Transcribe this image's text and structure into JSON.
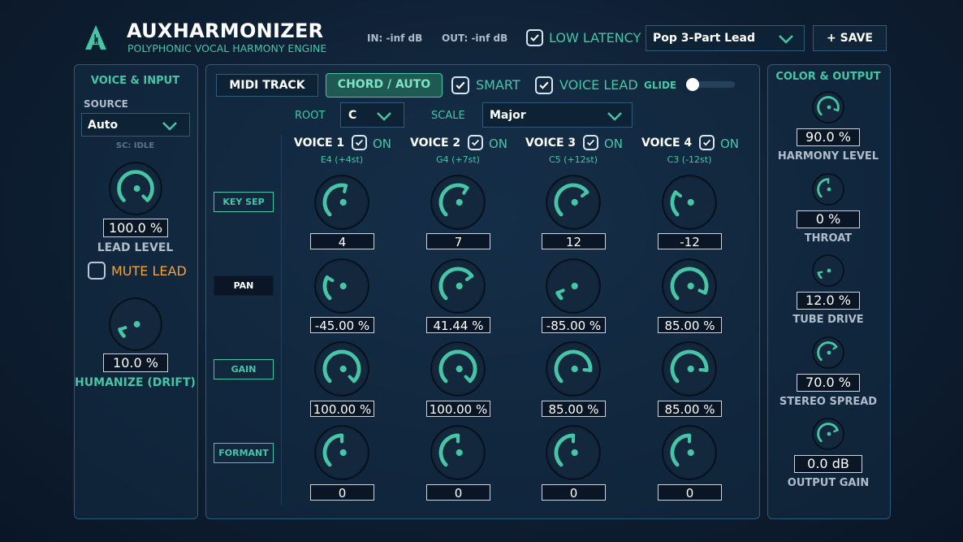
{
  "header": {
    "title": "AUXHARMONIZER",
    "subtitle": "POLYPHONIC VOCAL HARMONY ENGINE",
    "in_meter": "IN: -inf dB",
    "out_meter": "OUT: -inf dB",
    "low_latency_label": "LOW LATENCY",
    "low_latency_checked": true,
    "preset": "Pop 3-Part Lead",
    "save_label": "+ SAVE"
  },
  "voice_input": {
    "title": "VOICE & INPUT",
    "source_label": "SOURCE",
    "source_value": "Auto",
    "sc_status": "SC: IDLE",
    "lead_level_value": "100.0 %",
    "lead_level_label": "LEAD LEVEL",
    "lead_level_fraction": 1.0,
    "mute_lead_label": "MUTE LEAD",
    "mute_lead_checked": false,
    "humanize_value": "10.0 %",
    "humanize_label": "HUMANIZE (DRIFT)",
    "humanize_fraction": 0.1
  },
  "center": {
    "midi_track_label": "MIDI TRACK",
    "chord_auto_label": "CHORD / AUTO",
    "smart_label": "SMART",
    "smart_checked": true,
    "voice_lead_label": "VOICE LEAD",
    "voice_lead_checked": true,
    "glide_label": "GLIDE",
    "glide_fraction": 0.0,
    "root_label": "ROOT",
    "root_value": "C",
    "scale_label": "SCALE",
    "scale_value": "Major",
    "row_labels": [
      "KEY SEP",
      "PAN",
      "GAIN",
      "FORMANT"
    ],
    "on_label": "ON",
    "voices": [
      {
        "name": "VOICE 1",
        "note": "E4 (+4st)",
        "on": true,
        "values": [
          "4",
          "-45.00 %",
          "100.00 %",
          "0"
        ],
        "fractions": [
          0.55,
          0.28,
          1.0,
          0.5
        ]
      },
      {
        "name": "VOICE 2",
        "note": "G4 (+7st)",
        "on": true,
        "values": [
          "7",
          "41.44 %",
          "100.00 %",
          "0"
        ],
        "fractions": [
          0.62,
          0.7,
          1.0,
          0.5
        ]
      },
      {
        "name": "VOICE 3",
        "note": "C5 (+12st)",
        "on": true,
        "values": [
          "12",
          "-85.00 %",
          "85.00 %",
          "0"
        ],
        "fractions": [
          0.7,
          0.08,
          0.85,
          0.5
        ]
      },
      {
        "name": "VOICE 4",
        "note": "C3 (-12st)",
        "on": true,
        "values": [
          "-12",
          "85.00 %",
          "85.00 %",
          "0"
        ],
        "fractions": [
          0.3,
          0.92,
          0.85,
          0.5
        ]
      }
    ]
  },
  "color_output": {
    "title": "COLOR & OUTPUT",
    "knobs": [
      {
        "value": "90.0 %",
        "label": "HARMONY LEVEL",
        "fraction": 0.9
      },
      {
        "value": "0 %",
        "label": "THROAT",
        "fraction": 0.5
      },
      {
        "value": "12.0 %",
        "label": "TUBE DRIVE",
        "fraction": 0.12
      },
      {
        "value": "70.0 %",
        "label": "STEREO SPREAD",
        "fraction": 0.7
      },
      {
        "value": "0.0 dB",
        "label": "OUTPUT GAIN",
        "fraction": 0.75
      }
    ]
  },
  "colors": {
    "accent": "#46c6a6",
    "warning": "#f2a33a",
    "panel_border": "#2f5a7a"
  }
}
